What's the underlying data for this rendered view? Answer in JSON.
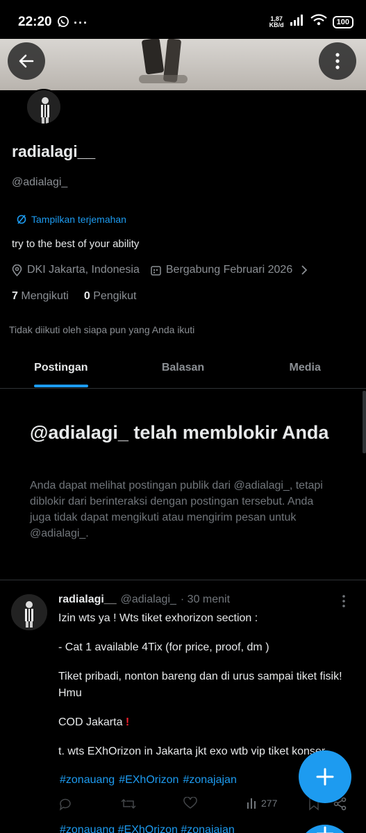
{
  "status_bar": {
    "time": "22:20",
    "net_speed": "1,87",
    "net_unit": "KB/d",
    "battery": "100"
  },
  "profile": {
    "name": "radialagi__",
    "handle": "@adialagi_",
    "translate_label": "Tampilkan terjemahan",
    "bio": "try to the best of your ability",
    "location": "DKI Jakarta, Indonesia",
    "joined": "Bergabung Februari 2026",
    "following_count": "7",
    "following_label": "Mengikuti",
    "followers_count": "0",
    "followers_label": "Pengikut",
    "not_followed_text": "Tidak diikuti oleh siapa pun yang Anda ikuti"
  },
  "tabs": [
    {
      "label": "Postingan",
      "active": true
    },
    {
      "label": "Balasan",
      "active": false
    },
    {
      "label": "Media",
      "active": false
    }
  ],
  "blocked": {
    "title": "@adialagi_ telah memblokir Anda",
    "description": "Anda dapat melihat postingan publik dari @adialagi_, tetapi diblokir dari berinteraksi dengan postingan tersebut. Anda juga tidak dapat mengikuti atau mengirim pesan untuk @adialagi_."
  },
  "post": {
    "name": "radialagi__",
    "handle": "@adialagi_",
    "time": "· 30 menit",
    "lines": [
      "Izin wts ya ! Wts tiket exhorizon section :",
      "- Cat 1 available 4Tix (for price, proof, dm )",
      "Tiket pribadi, nonton bareng dan di urus sampai tiket fisik! Hmu",
      "COD Jakarta",
      "t. wts EXhOrizon in Jakarta jkt exo wtb vip tiket konser"
    ],
    "tags": [
      "#zonauang",
      "#EXhOrizon",
      "#zonajajan"
    ],
    "views": "277"
  },
  "next_post": {
    "tags_text": "#zonauang #EXhOrizon #zonajajan"
  },
  "colors": {
    "accent": "#1d9bf0",
    "background": "#000000",
    "muted": "#71767b",
    "red_mark": "#f4212e"
  }
}
